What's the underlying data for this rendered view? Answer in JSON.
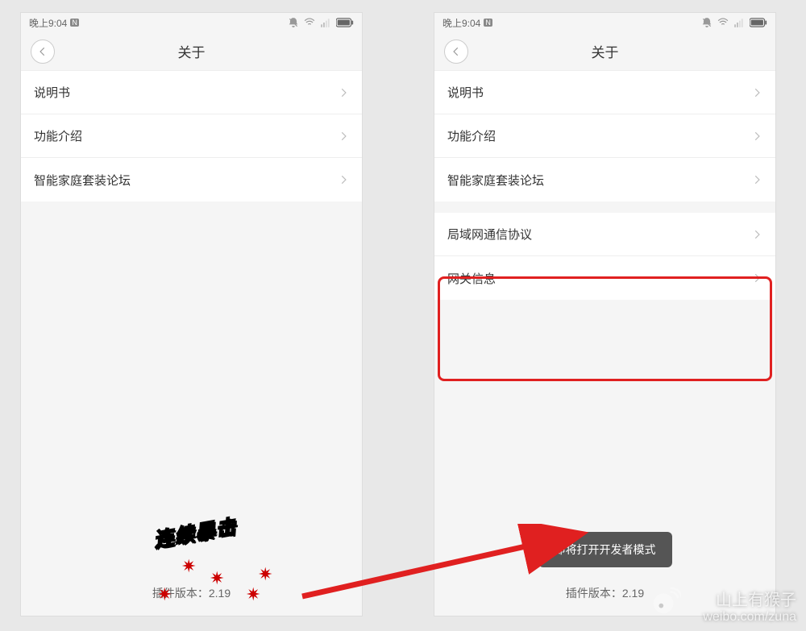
{
  "status": {
    "time": "晚上9:04",
    "badge": "N"
  },
  "nav": {
    "title": "关于"
  },
  "left": {
    "rows": [
      {
        "label": "说明书"
      },
      {
        "label": "功能介绍"
      },
      {
        "label": "智能家庭套装论坛"
      }
    ],
    "version": "插件版本：2.19",
    "annotation": "连续暴击"
  },
  "right": {
    "rows_group1": [
      {
        "label": "说明书"
      },
      {
        "label": "功能介绍"
      },
      {
        "label": "智能家庭套装论坛"
      }
    ],
    "rows_group2": [
      {
        "label": "局域网通信协议"
      },
      {
        "label": "网关信息"
      }
    ],
    "version": "插件版本：2.19",
    "toast": "即将打开开发者模式"
  },
  "watermark": {
    "line1": "山上有猴子",
    "line2": "weibo.com/zuna"
  }
}
